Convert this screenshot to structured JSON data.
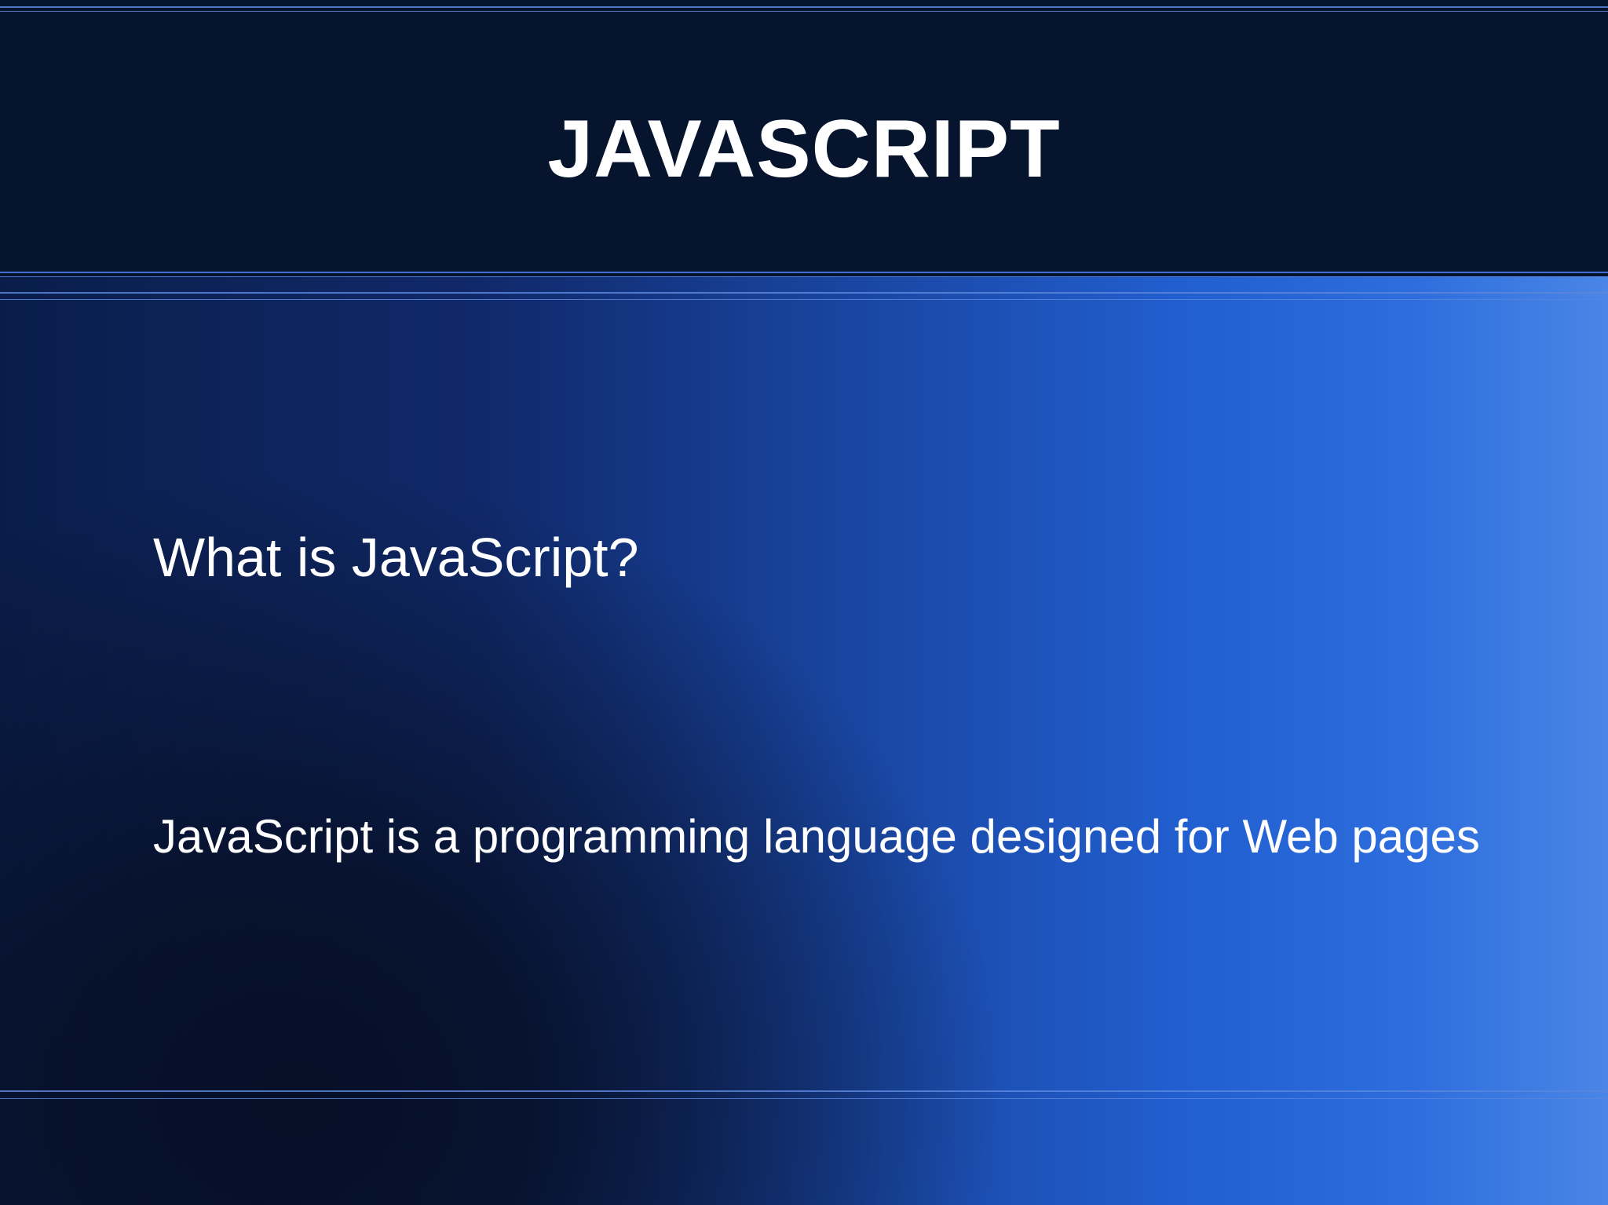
{
  "slide": {
    "title": "JAVASCRIPT",
    "question": "What is JavaScript?",
    "answer": "JavaScript is a programming language designed for Web pages"
  },
  "colors": {
    "title_band": "#06142e",
    "accent_line": "#3f6fd0",
    "text": "#ffffff",
    "background_light": "#2e6ddd",
    "background_dark": "#060f26"
  }
}
